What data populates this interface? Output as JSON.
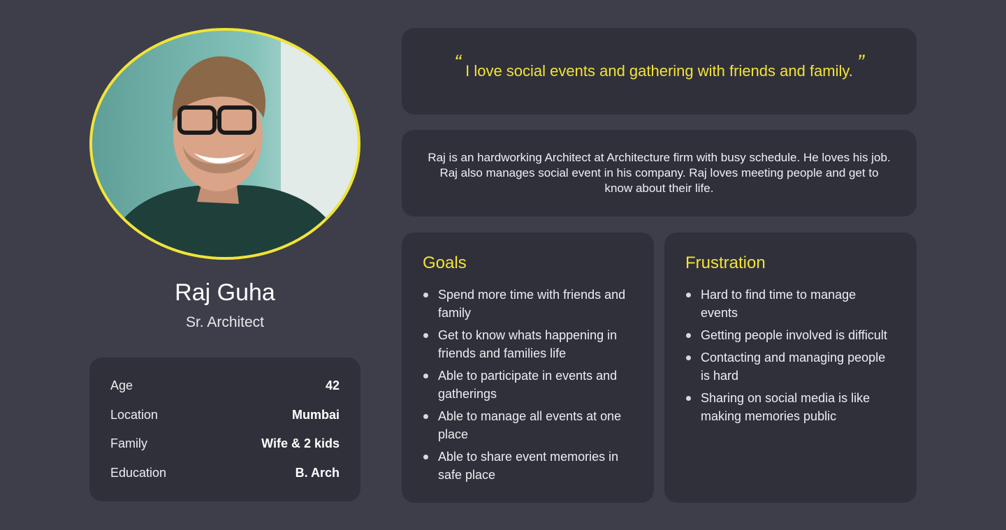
{
  "profile": {
    "name": "Raj Guha",
    "role": "Sr. Architect",
    "photo_icon": "person-photo"
  },
  "info": [
    {
      "label": "Age",
      "value": "42"
    },
    {
      "label": "Location",
      "value": "Mumbai"
    },
    {
      "label": "Family",
      "value": "Wife & 2 kids"
    },
    {
      "label": "Education",
      "value": "B. Arch"
    }
  ],
  "quote": {
    "open_mark": "“",
    "text": "I love social events and gathering with friends and family.",
    "close_mark": "”"
  },
  "bio": "Raj is an hardworking Architect at Architecture firm with busy schedule. He loves his job. Raj also manages social event in his company. Raj loves meeting people and get to know about their life.",
  "goals": {
    "title": "Goals",
    "items": [
      "Spend more time with friends and family",
      "Get to know whats happening in friends and families life",
      "Able to participate in events and gatherings",
      "Able to manage all events at one place",
      "Able to share event memories in safe place"
    ]
  },
  "frustration": {
    "title": "Frustration",
    "items": [
      "Hard to find time to manage events",
      "Getting people involved is difficult",
      "Contacting and managing people is hard",
      "Sharing on social media is like making memories public"
    ]
  },
  "colors": {
    "background": "#3d3e4a",
    "card": "#30303b",
    "accent": "#f2e435"
  }
}
